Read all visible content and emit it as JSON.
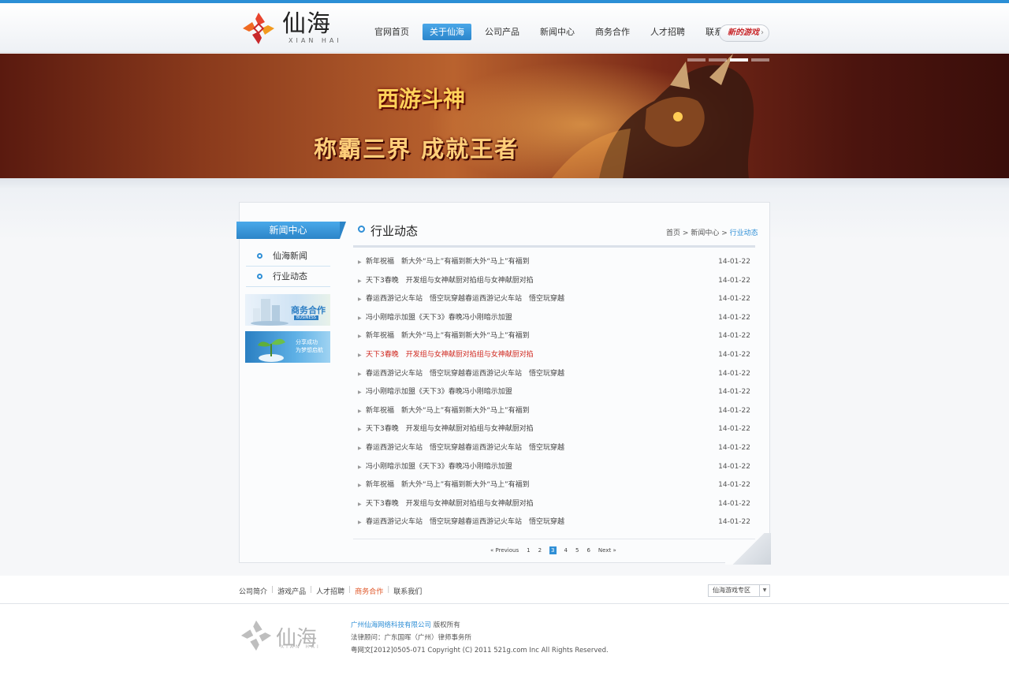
{
  "brand": {
    "logo_text": "仙海",
    "logo_sub": "XIAN HAI"
  },
  "nav": {
    "items": [
      {
        "label": "官网首页",
        "active": false
      },
      {
        "label": "关于仙海",
        "active": true
      },
      {
        "label": "公司产品",
        "active": false
      },
      {
        "label": "新闻中心",
        "active": false
      },
      {
        "label": "商务合作",
        "active": false
      },
      {
        "label": "人才招聘",
        "active": false
      },
      {
        "label": "联系我们",
        "active": false
      }
    ],
    "new_game_label": "新的游戏",
    "new_game_chevron": "›"
  },
  "banner": {
    "game_logo": "西游斗神",
    "slogan": "称霸三界 成就王者",
    "slides": 4,
    "active_slide": 3
  },
  "sidebar": {
    "title": "新闻中心",
    "items": [
      {
        "label": "仙海新闻"
      },
      {
        "label": "行业动态"
      }
    ],
    "promo_business": {
      "title": "商务合作",
      "sub": "BUSINESS"
    },
    "promo_share": {
      "line1": "分享成功",
      "line2": "为梦想启航"
    }
  },
  "main": {
    "title": "行业动态",
    "breadcrumb": {
      "home": "首页",
      "sep": ">",
      "section": "新闻中心",
      "current": "行业动态"
    },
    "news": [
      {
        "title": "新年祝福　新大外“马上”有福到新大外“马上”有福到",
        "date": "14-01-22",
        "highlight": false
      },
      {
        "title": "天下3春晚　开发组与女神献厨对掐组与女神献厨对掐",
        "date": "14-01-22",
        "highlight": false
      },
      {
        "title": "春运西游记火车站　悟空玩穿越春运西游记火车站　悟空玩穿越",
        "date": "14-01-22",
        "highlight": false
      },
      {
        "title": "冯小刚暗示加盟《天下3》春晚冯小刚暗示加盟",
        "date": "14-01-22",
        "highlight": false
      },
      {
        "title": "新年祝福　新大外“马上”有福到新大外“马上”有福到",
        "date": "14-01-22",
        "highlight": false
      },
      {
        "title": "天下3春晚　开发组与女神献厨对掐组与女神献厨对掐",
        "date": "14-01-22",
        "highlight": true
      },
      {
        "title": "春运西游记火车站　悟空玩穿越春运西游记火车站　悟空玩穿越",
        "date": "14-01-22",
        "highlight": false
      },
      {
        "title": "冯小刚暗示加盟《天下3》春晚冯小刚暗示加盟",
        "date": "14-01-22",
        "highlight": false
      },
      {
        "title": "新年祝福　新大外“马上”有福到新大外“马上”有福到",
        "date": "14-01-22",
        "highlight": false
      },
      {
        "title": "天下3春晚　开发组与女神献厨对掐组与女神献厨对掐",
        "date": "14-01-22",
        "highlight": false
      },
      {
        "title": "春运西游记火车站　悟空玩穿越春运西游记火车站　悟空玩穿越",
        "date": "14-01-22",
        "highlight": false
      },
      {
        "title": "冯小刚暗示加盟《天下3》春晚冯小刚暗示加盟",
        "date": "14-01-22",
        "highlight": false
      },
      {
        "title": "新年祝福　新大外“马上”有福到新大外“马上”有福到",
        "date": "14-01-22",
        "highlight": false
      },
      {
        "title": "天下3春晚　开发组与女神献厨对掐组与女神献厨对掐",
        "date": "14-01-22",
        "highlight": false
      },
      {
        "title": "春运西游记火车站　悟空玩穿越春运西游记火车站　悟空玩穿越",
        "date": "14-01-22",
        "highlight": false
      }
    ],
    "pager": {
      "prev": "« Previous",
      "pages": [
        "1",
        "2",
        "3",
        "4",
        "5",
        "6"
      ],
      "current": "3",
      "next": "Next »"
    }
  },
  "footer_nav": {
    "links": [
      "公司简介",
      "游戏产品",
      "人才招聘",
      "商务合作",
      "联系我们"
    ],
    "highlight_index": 3,
    "select_value": "仙海游戏专区"
  },
  "footer": {
    "company": "广州仙海网络科技有限公司",
    "rights": "版权所有",
    "lawyer": "法律顾问：广东国晖（广州）律师事务所",
    "license": "粤网文[2012]0505-071 Copyright (C) 2011 521g.com Inc All Rights Reserved."
  },
  "colors": {
    "accent": "#2f8fd6",
    "highlight": "#d0281f",
    "footer_hot": "#e0582a"
  }
}
